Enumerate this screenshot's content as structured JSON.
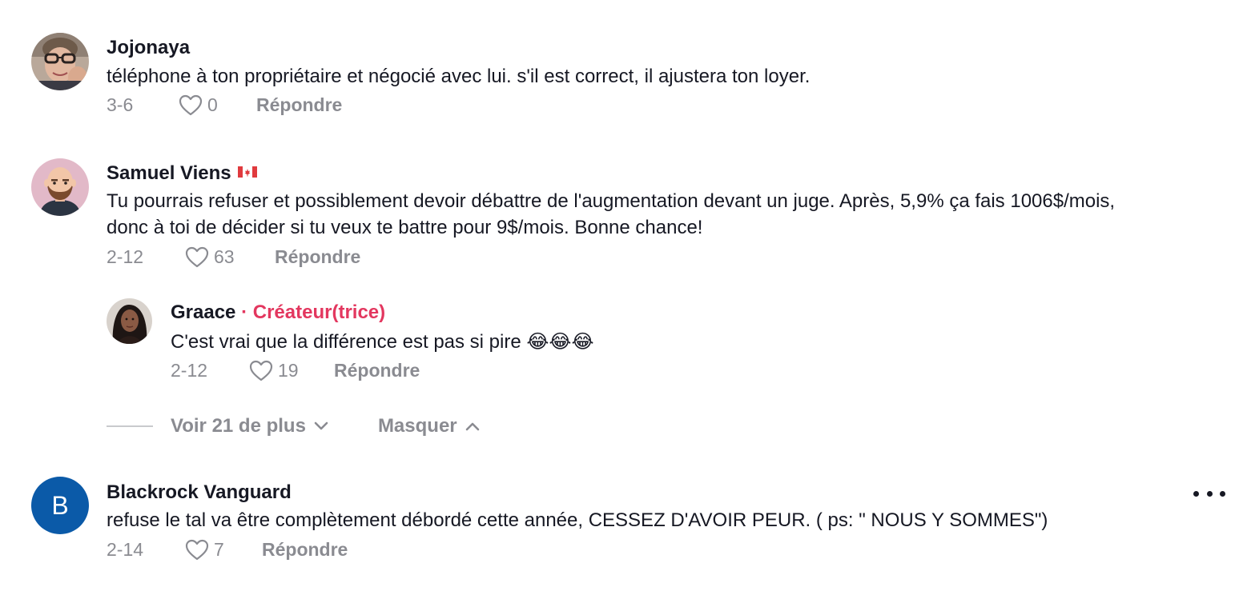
{
  "comments": [
    {
      "author": "Jojonaya",
      "text": "téléphone à ton propriétaire et négocié avec lui. s'il est correct, il ajustera ton loyer.",
      "date": "3-6",
      "likes": "0",
      "reply_label": "Répondre",
      "avatar_icon": "photo-avatar-woman-glasses"
    },
    {
      "author": "Samuel Viens",
      "author_flag": "canada-flag-icon",
      "text_line1": "Tu pourrais refuser et possiblement devoir débattre de l'augmentation devant un juge. Après, 5,9% ça fais 1006$/mois,",
      "text_line2": "donc à toi de décider si tu veux te battre pour 9$/mois. Bonne chance!",
      "date": "2-12",
      "likes": "63",
      "reply_label": "Répondre",
      "avatar_icon": "cartoon-avatar-bald-beard"
    },
    {
      "author": "Graace",
      "separator": "·",
      "creator_badge": "Créateur(trice)",
      "text": "C'est vrai que la différence est pas si pire 😂😂😂",
      "date": "2-12",
      "likes": "19",
      "reply_label": "Répondre",
      "avatar_icon": "photo-avatar-woman"
    },
    {
      "author": "Blackrock Vanguard",
      "avatar_letter": "B",
      "text": "refuse le tal va être complètement débordé cette année, CESSEZ D'AVOIR PEUR. ( ps: \" NOUS Y SOMMES\")",
      "date": "2-14",
      "likes": "7",
      "reply_label": "Répondre"
    }
  ],
  "replies_controls": {
    "view_more": "Voir 21 de plus",
    "hide": "Masquer"
  },
  "colors": {
    "creator_accent": "#e3375f",
    "meta_gray": "#8a8b91",
    "avatar_blue": "#0b5aa8"
  }
}
